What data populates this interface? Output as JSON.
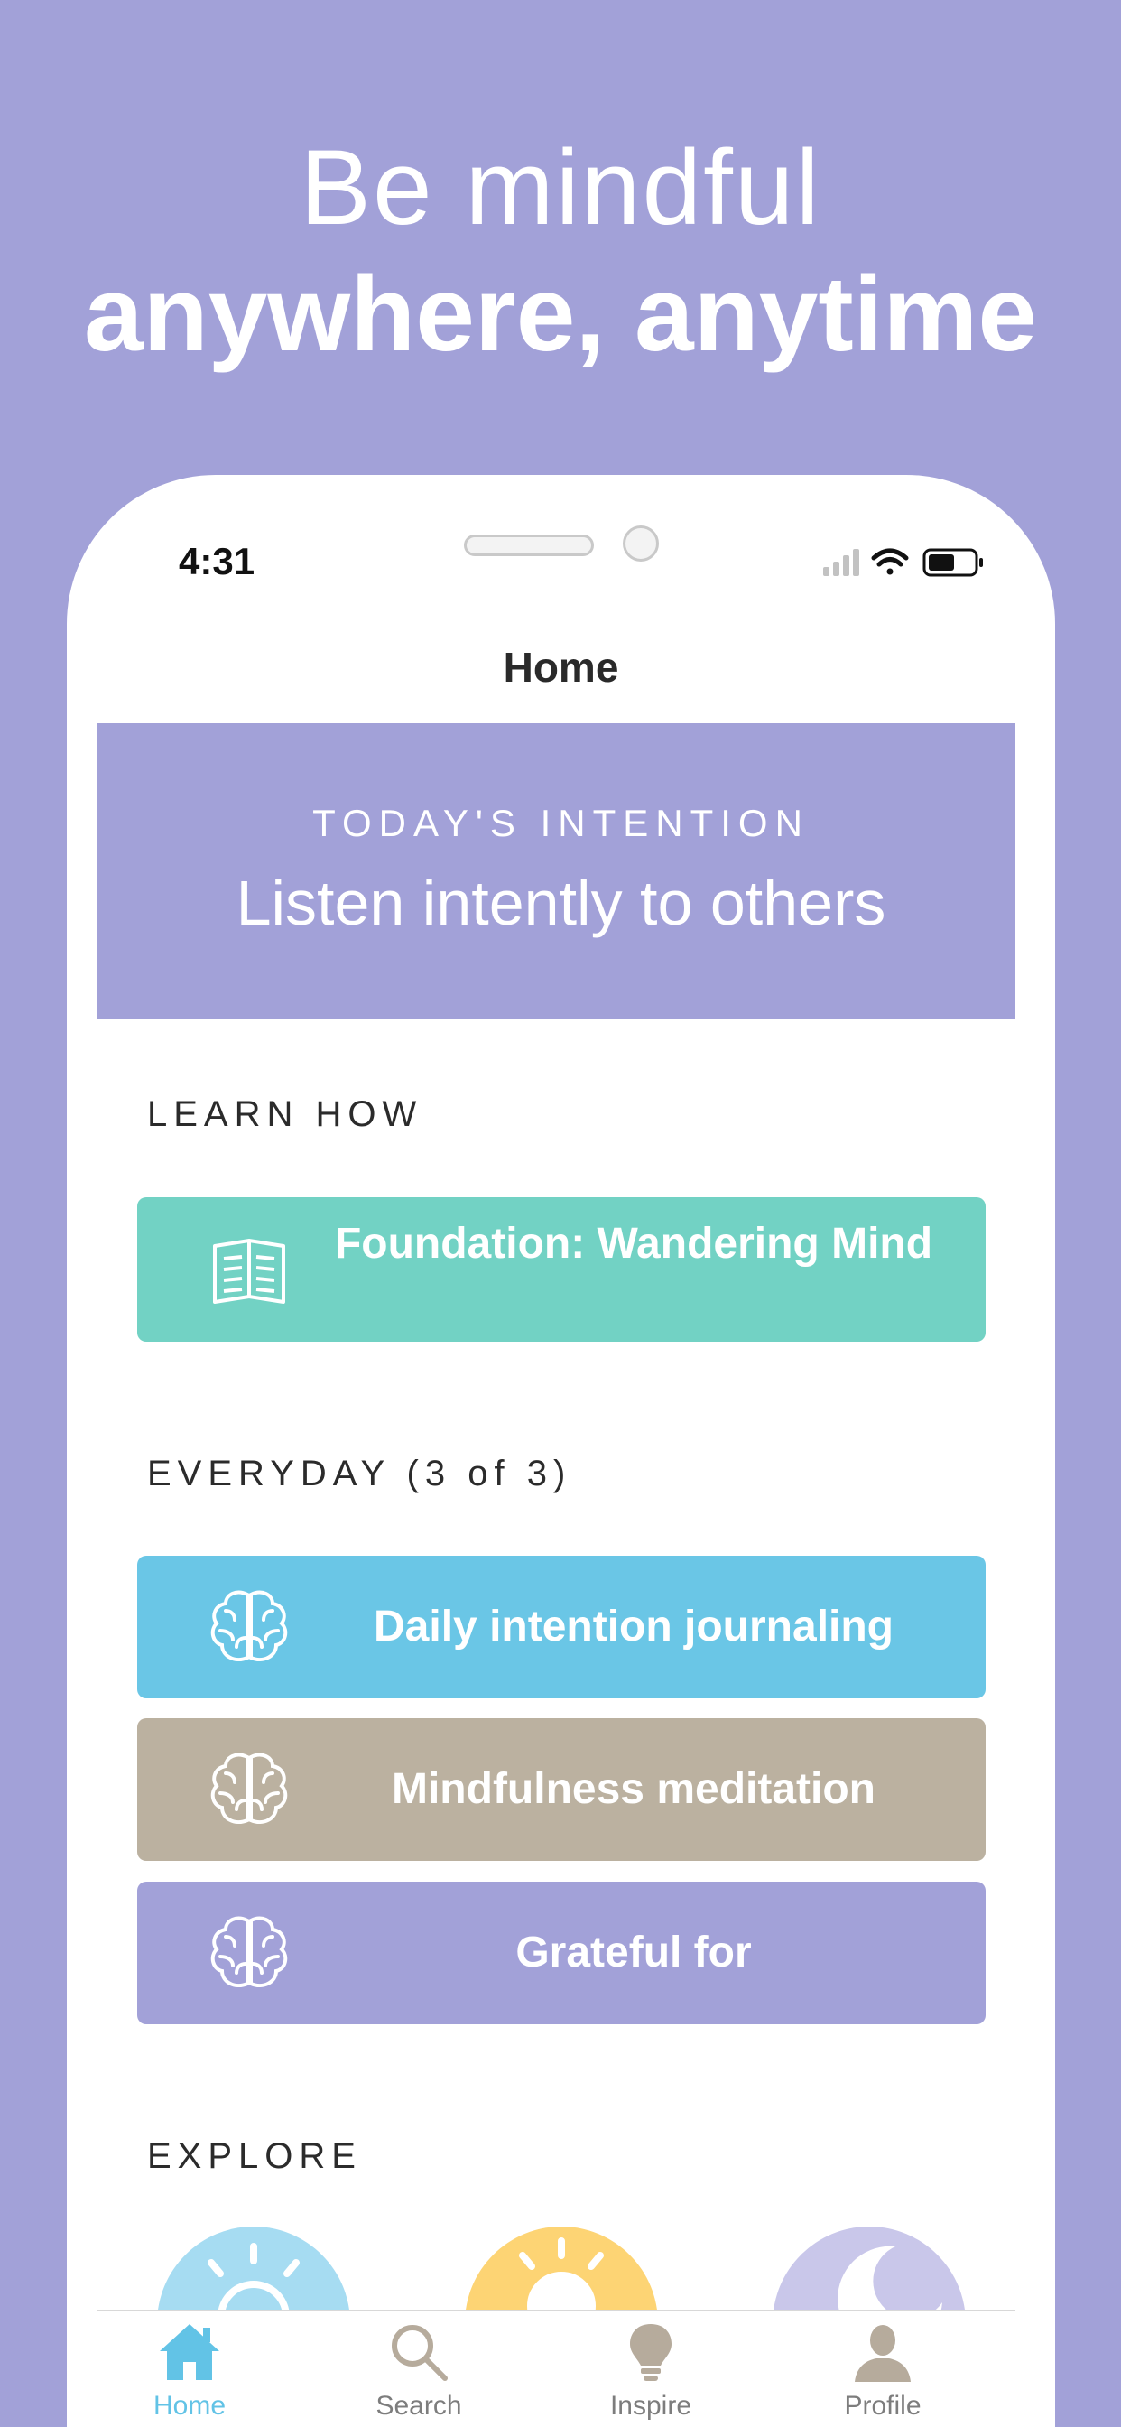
{
  "promo": {
    "line1": "Be mindful",
    "line2": "anywhere, anytime"
  },
  "status_bar": {
    "time": "4:31"
  },
  "nav": {
    "title": "Home"
  },
  "intention": {
    "label": "TODAY'S INTENTION",
    "text": "Listen intently to others",
    "color": "#a2a1d8"
  },
  "learn_how": {
    "label": "LEARN HOW",
    "card": {
      "label": "Foundation: Wandering Mind",
      "icon": "book-icon",
      "color": "#72d2c4"
    }
  },
  "everyday": {
    "label": "EVERYDAY (3 of 3)",
    "items": [
      {
        "label": "Daily intention journaling",
        "icon": "brain-icon",
        "color": "#6ac6e6"
      },
      {
        "label": "Mindfulness meditation",
        "icon": "brain-icon",
        "color": "#bbb1a0"
      },
      {
        "label": "Grateful for",
        "icon": "brain-icon",
        "color": "#a2a1d8"
      }
    ]
  },
  "explore": {
    "label": "EXPLORE",
    "items": [
      {
        "icon": "sunrise-icon",
        "color": "#a6dcf2"
      },
      {
        "icon": "sun-icon",
        "color": "#fdd474"
      },
      {
        "icon": "moon-icon",
        "color": "#c9c7ea"
      }
    ]
  },
  "tabbar": {
    "tabs": [
      {
        "label": "Home",
        "icon": "home-icon",
        "active": true
      },
      {
        "label": "Search",
        "icon": "search-icon",
        "active": false
      },
      {
        "label": "Inspire",
        "icon": "lightbulb-icon",
        "active": false
      },
      {
        "label": "Profile",
        "icon": "profile-icon",
        "active": false
      }
    ],
    "active_color": "#62c3e6",
    "inactive_color": "#b6ab9c"
  }
}
